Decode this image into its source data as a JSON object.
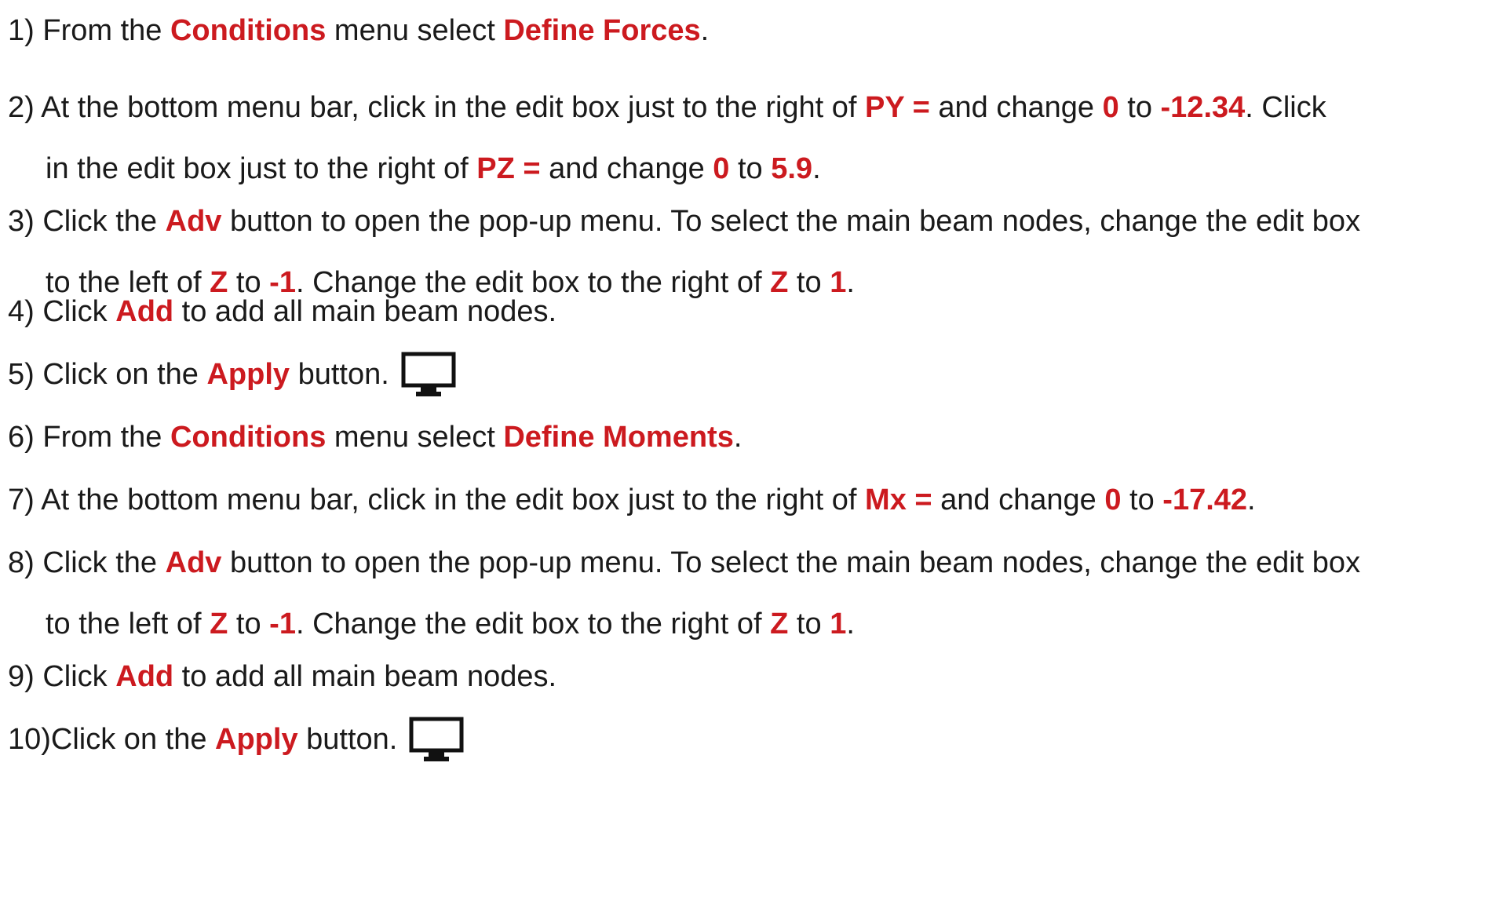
{
  "steps": [
    {
      "num": "1)",
      "lines": [
        [
          {
            "t": " From the ",
            "hl": false
          },
          {
            "t": "Conditions",
            "hl": true
          },
          {
            "t": " menu select ",
            "hl": false
          },
          {
            "t": "Define Forces",
            "hl": true
          },
          {
            "t": ".",
            "hl": false
          }
        ]
      ]
    },
    {
      "num": "2)",
      "lines": [
        [
          {
            "t": " At the bottom menu bar, click in the edit box just to the right of ",
            "hl": false
          },
          {
            "t": "PY =",
            "hl": true
          },
          {
            "t": " and change ",
            "hl": false
          },
          {
            "t": "0",
            "hl": true
          },
          {
            "t": " to ",
            "hl": false
          },
          {
            "t": "-12.34",
            "hl": true
          },
          {
            "t": ". Click",
            "hl": false
          }
        ],
        [
          {
            "t": "in the edit box just to the right of ",
            "hl": false
          },
          {
            "t": "PZ =",
            "hl": true
          },
          {
            "t": " and change ",
            "hl": false
          },
          {
            "t": "0",
            "hl": true
          },
          {
            "t": " to ",
            "hl": false
          },
          {
            "t": "5.9",
            "hl": true
          },
          {
            "t": ".",
            "hl": false
          }
        ]
      ]
    },
    {
      "num": "3)",
      "lines": [
        [
          {
            "t": " Click the ",
            "hl": false
          },
          {
            "t": "Adv",
            "hl": true
          },
          {
            "t": " button to open the pop-up menu. To select the main beam nodes, change the edit box",
            "hl": false
          }
        ],
        [
          {
            "t": "to the left of ",
            "hl": false
          },
          {
            "t": "Z",
            "hl": true
          },
          {
            "t": " to ",
            "hl": false
          },
          {
            "t": "-1",
            "hl": true
          },
          {
            "t": ". Change the edit box to the right of ",
            "hl": false
          },
          {
            "t": "Z",
            "hl": true
          },
          {
            "t": " to ",
            "hl": false
          },
          {
            "t": "1",
            "hl": true
          },
          {
            "t": ".",
            "hl": false
          }
        ]
      ]
    },
    {
      "num": "4)",
      "lines": [
        [
          {
            "t": " Click ",
            "hl": false
          },
          {
            "t": "Add",
            "hl": true
          },
          {
            "t": " to add all main beam nodes.",
            "hl": false
          }
        ]
      ]
    },
    {
      "num": "5)",
      "icon": "monitor-icon",
      "lines": [
        [
          {
            "t": " Click on the ",
            "hl": false
          },
          {
            "t": "Apply",
            "hl": true
          },
          {
            "t": " button.",
            "hl": false
          }
        ]
      ]
    },
    {
      "num": "6)",
      "lines": [
        [
          {
            "t": " From the ",
            "hl": false
          },
          {
            "t": "Conditions",
            "hl": true
          },
          {
            "t": " menu select ",
            "hl": false
          },
          {
            "t": "Define Moments",
            "hl": true
          },
          {
            "t": ".",
            "hl": false
          }
        ]
      ]
    },
    {
      "num": "7)",
      "lines": [
        [
          {
            "t": " At the bottom menu bar, click in the edit box just to the right of ",
            "hl": false
          },
          {
            "t": "Mx =",
            "hl": true
          },
          {
            "t": " and change ",
            "hl": false
          },
          {
            "t": "0",
            "hl": true
          },
          {
            "t": " to ",
            "hl": false
          },
          {
            "t": "-17.42",
            "hl": true
          },
          {
            "t": ".",
            "hl": false
          }
        ]
      ]
    },
    {
      "num": "8)",
      "lines": [
        [
          {
            "t": " Click the ",
            "hl": false
          },
          {
            "t": "Adv",
            "hl": true
          },
          {
            "t": " button to open the pop-up menu. To select the main beam nodes, change the edit box",
            "hl": false
          }
        ],
        [
          {
            "t": "to the left of ",
            "hl": false
          },
          {
            "t": "Z",
            "hl": true
          },
          {
            "t": " to ",
            "hl": false
          },
          {
            "t": "-1",
            "hl": true
          },
          {
            "t": ". Change the edit box to the right of ",
            "hl": false
          },
          {
            "t": "Z",
            "hl": true
          },
          {
            "t": " to ",
            "hl": false
          },
          {
            "t": "1",
            "hl": true
          },
          {
            "t": ".",
            "hl": false
          }
        ]
      ]
    },
    {
      "num": "9)",
      "lines": [
        [
          {
            "t": " Click ",
            "hl": false
          },
          {
            "t": "Add",
            "hl": true
          },
          {
            "t": " to add all main beam nodes.",
            "hl": false
          }
        ]
      ]
    },
    {
      "num": "10)",
      "icon": "monitor-icon",
      "lines": [
        [
          {
            "t": "Click on the ",
            "hl": false
          },
          {
            "t": "Apply",
            "hl": true
          },
          {
            "t": " button.",
            "hl": false
          }
        ]
      ]
    }
  ],
  "colors": {
    "highlight": "#cc1a1f",
    "text": "#1a1a1a"
  }
}
